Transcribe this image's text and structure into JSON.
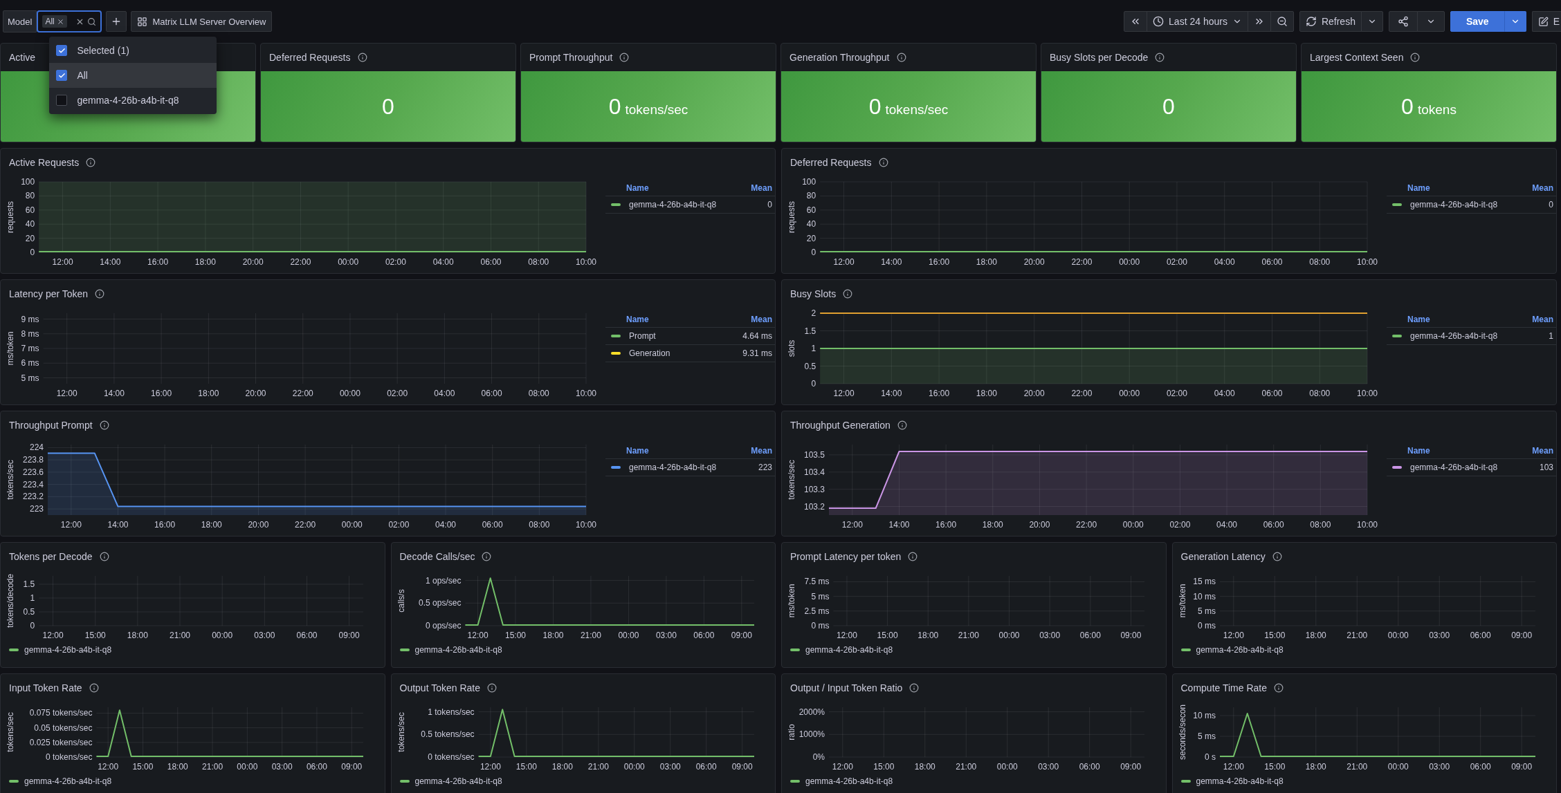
{
  "toolbar": {
    "variable": {
      "label": "Model",
      "chips": [
        "All"
      ]
    },
    "dashboard_link": "Matrix LLM Server Overview",
    "time_range": "Last 24 hours",
    "refresh": "Refresh",
    "save": "Save",
    "edit": "E"
  },
  "dropdown": {
    "options": [
      {
        "label": "Selected (1)",
        "checked": true,
        "selected": false
      },
      {
        "label": "All",
        "checked": true,
        "selected": true
      },
      {
        "label": "gemma-4-26b-a4b-it-q8",
        "checked": false,
        "selected": false
      }
    ]
  },
  "stats": [
    {
      "title": "Active"
    },
    {
      "title": "Deferred Requests",
      "value": "0"
    },
    {
      "title": "Prompt Throughput",
      "value": "0",
      "unit": "tokens/sec"
    },
    {
      "title": "Generation Throughput",
      "value": "0",
      "unit": "tokens/sec"
    },
    {
      "title": "Busy Slots per Decode",
      "value": "0"
    },
    {
      "title": "Largest Context Seen",
      "value": "0",
      "unit": "tokens"
    }
  ],
  "panels": [
    {
      "title": "Active Requests",
      "kind": "wide",
      "legend_columns": [
        "Name",
        "Mean"
      ],
      "legend_means": [
        "0"
      ],
      "chart_data": {
        "type": "line",
        "ylabel": "requests",
        "grid": true,
        "ylim": [
          0,
          100
        ],
        "yticks": [
          {
            "value": 0,
            "label": "0"
          },
          {
            "value": 20,
            "label": "20"
          },
          {
            "value": 40,
            "label": "40"
          },
          {
            "value": 60,
            "label": "60"
          },
          {
            "value": 80,
            "label": "80"
          },
          {
            "value": 100,
            "label": "100"
          }
        ],
        "categories": [
          null,
          "12:00",
          null,
          "14:00",
          null,
          "16:00",
          null,
          "18:00",
          null,
          "20:00",
          null,
          "22:00",
          null,
          "00:00",
          null,
          "02:00",
          null,
          "04:00",
          null,
          "06:00",
          null,
          "08:00",
          null,
          "10:00"
        ],
        "series": [
          {
            "name": "gemma-4-26b-a4b-it-q8",
            "color": "#73bf69",
            "values": [
              0,
              0,
              0,
              0,
              0,
              0,
              0,
              0,
              0,
              0,
              0,
              0,
              0,
              0,
              0,
              0,
              0,
              0,
              0,
              0,
              0,
              0,
              0,
              0
            ]
          }
        ],
        "bands": [
          {
            "axis": "y",
            "from": 0,
            "to": 100,
            "color": "#73bf69"
          }
        ]
      }
    },
    {
      "title": "Deferred Requests",
      "kind": "wide",
      "legend_columns": [
        "Name",
        "Mean"
      ],
      "legend_means": [
        "0"
      ],
      "chart_data": {
        "type": "line",
        "ylabel": "requests",
        "grid": true,
        "ylim": [
          0,
          100
        ],
        "yticks": [
          {
            "value": 0,
            "label": "0"
          },
          {
            "value": 20,
            "label": "20"
          },
          {
            "value": 40,
            "label": "40"
          },
          {
            "value": 60,
            "label": "60"
          },
          {
            "value": 80,
            "label": "80"
          },
          {
            "value": 100,
            "label": "100"
          }
        ],
        "categories": [
          null,
          "12:00",
          null,
          "14:00",
          null,
          "16:00",
          null,
          "18:00",
          null,
          "20:00",
          null,
          "22:00",
          null,
          "00:00",
          null,
          "02:00",
          null,
          "04:00",
          null,
          "06:00",
          null,
          "08:00",
          null,
          "10:00"
        ],
        "series": [
          {
            "name": "gemma-4-26b-a4b-it-q8",
            "color": "#73bf69",
            "values": [
              0,
              0,
              0,
              0,
              0,
              0,
              0,
              0,
              0,
              0,
              0,
              0,
              0,
              0,
              0,
              0,
              0,
              0,
              0,
              0,
              0,
              0,
              0,
              0
            ]
          }
        ]
      }
    },
    {
      "title": "Latency per Token",
      "kind": "wide",
      "legend_columns": [
        "Name",
        "Mean"
      ],
      "legend_means": [
        "4.64 ms",
        "9.31 ms"
      ],
      "chart_data": {
        "type": "line",
        "ylabel": "ms/token",
        "grid": true,
        "ylim": [
          4.6,
          9.4
        ],
        "yticks": [
          {
            "value": 5,
            "label": "5 ms"
          },
          {
            "value": 6,
            "label": "6 ms"
          },
          {
            "value": 7,
            "label": "7 ms"
          },
          {
            "value": 8,
            "label": "8 ms"
          },
          {
            "value": 9,
            "label": "9 ms"
          }
        ],
        "categories": [
          null,
          "12:00",
          null,
          "14:00",
          null,
          "16:00",
          null,
          "18:00",
          null,
          "20:00",
          null,
          "22:00",
          null,
          "00:00",
          null,
          "02:00",
          null,
          "04:00",
          null,
          "06:00",
          null,
          "08:00",
          null,
          "10:00"
        ],
        "series": [
          {
            "name": "Prompt",
            "color": "#73bf69",
            "values": [
              null,
              null,
              null,
              null,
              null,
              null,
              null,
              null,
              null,
              null,
              null,
              null,
              null,
              null,
              null,
              null,
              null,
              null,
              null,
              null,
              null,
              null,
              null,
              null
            ]
          },
          {
            "name": "Generation",
            "color": "#fade2a",
            "values": [
              null,
              null,
              null,
              null,
              null,
              null,
              null,
              null,
              null,
              null,
              null,
              null,
              null,
              null,
              null,
              null,
              null,
              null,
              null,
              null,
              null,
              null,
              null,
              null
            ]
          }
        ]
      }
    },
    {
      "title": "Busy Slots",
      "kind": "wide",
      "legend_columns": [
        "Name",
        "Mean"
      ],
      "legend_means": [
        "1"
      ],
      "chart_data": {
        "type": "area",
        "ylabel": "slots",
        "grid": true,
        "ylim": [
          0,
          2
        ],
        "yticks": [
          {
            "value": 0,
            "label": "0"
          },
          {
            "value": 0.5,
            "label": "0.5"
          },
          {
            "value": 1,
            "label": "1"
          },
          {
            "value": 1.5,
            "label": "1.5"
          },
          {
            "value": 2,
            "label": "2"
          }
        ],
        "categories": [
          null,
          "12:00",
          null,
          "14:00",
          null,
          "16:00",
          null,
          "18:00",
          null,
          "20:00",
          null,
          "22:00",
          null,
          "00:00",
          null,
          "02:00",
          null,
          "04:00",
          null,
          "06:00",
          null,
          "08:00",
          null,
          "10:00"
        ],
        "series": [
          {
            "name": "gemma-4-26b-a4b-it-q8",
            "color": "#73bf69",
            "values": [
              1,
              1,
              1,
              1,
              1,
              1,
              1,
              1,
              1,
              1,
              1,
              1,
              1,
              1,
              1,
              1,
              1,
              1,
              1,
              1,
              1,
              1,
              1,
              1
            ]
          }
        ],
        "ref_lines": [
          {
            "axis": "y",
            "value": 2,
            "color": "#e0a030"
          }
        ]
      }
    },
    {
      "title": "Throughput Prompt",
      "kind": "wide",
      "legend_columns": [
        "Name",
        "Mean"
      ],
      "legend_means": [
        "223"
      ],
      "chart_data": {
        "type": "area",
        "ylabel": "tokens/sec",
        "grid": true,
        "ylim": [
          222.9,
          224.05
        ],
        "yticks": [
          {
            "value": 223,
            "label": "223"
          },
          {
            "value": 223.2,
            "label": "223.2"
          },
          {
            "value": 223.4,
            "label": "223.4"
          },
          {
            "value": 223.6,
            "label": "223.6"
          },
          {
            "value": 223.8,
            "label": "223.8"
          },
          {
            "value": 224,
            "label": "224"
          }
        ],
        "categories": [
          null,
          "12:00",
          null,
          "14:00",
          null,
          "16:00",
          null,
          "18:00",
          null,
          "20:00",
          null,
          "22:00",
          null,
          "00:00",
          null,
          "02:00",
          null,
          "04:00",
          null,
          "06:00",
          null,
          "08:00",
          null,
          "10:00"
        ],
        "series": [
          {
            "name": "gemma-4-26b-a4b-it-q8",
            "color": "#5794f2",
            "values": [
              223.91,
              223.91,
              223.91,
              223.04,
              223.04,
              223.04,
              223.04,
              223.04,
              223.04,
              223.04,
              223.04,
              223.04,
              223.04,
              223.04,
              223.04,
              223.04,
              223.04,
              223.04,
              223.04,
              223.04,
              223.04,
              223.04,
              223.04,
              223.04
            ]
          }
        ]
      }
    },
    {
      "title": "Throughput Generation",
      "kind": "wide",
      "legend_columns": [
        "Name",
        "Mean"
      ],
      "legend_means": [
        "103"
      ],
      "chart_data": {
        "type": "area",
        "ylabel": "tokens/sec",
        "grid": true,
        "ylim": [
          103.15,
          103.56
        ],
        "yticks": [
          {
            "value": 103.2,
            "label": "103.2"
          },
          {
            "value": 103.3,
            "label": "103.3"
          },
          {
            "value": 103.4,
            "label": "103.4"
          },
          {
            "value": 103.5,
            "label": "103.5"
          }
        ],
        "categories": [
          null,
          "12:00",
          null,
          "14:00",
          null,
          "16:00",
          null,
          "18:00",
          null,
          "20:00",
          null,
          "22:00",
          null,
          "00:00",
          null,
          "02:00",
          null,
          "04:00",
          null,
          "06:00",
          null,
          "08:00",
          null,
          "10:00"
        ],
        "series": [
          {
            "name": "gemma-4-26b-a4b-it-q8",
            "color": "#ca95e5",
            "values": [
              103.19,
              103.19,
              103.19,
              103.52,
              103.52,
              103.52,
              103.52,
              103.52,
              103.52,
              103.52,
              103.52,
              103.52,
              103.52,
              103.52,
              103.52,
              103.52,
              103.52,
              103.52,
              103.52,
              103.52,
              103.52,
              103.52,
              103.52,
              103.52
            ]
          }
        ]
      }
    },
    {
      "title": "Tokens per Decode",
      "kind": "small",
      "chart_data": {
        "type": "line",
        "ylabel": "tokens/decode",
        "grid": true,
        "ylim": [
          0,
          1.8
        ],
        "yticks": [
          {
            "value": 0,
            "label": "0"
          },
          {
            "value": 0.5,
            "label": "0.5"
          },
          {
            "value": 1,
            "label": "1"
          },
          {
            "value": 1.5,
            "label": "1.5"
          }
        ],
        "categories": [
          null,
          "12:00",
          null,
          null,
          "15:00",
          null,
          null,
          "18:00",
          null,
          null,
          "21:00",
          null,
          null,
          "00:00",
          null,
          null,
          "03:00",
          null,
          null,
          "06:00",
          null,
          null,
          "09:00",
          null
        ],
        "series": [
          {
            "name": "gemma-4-26b-a4b-it-q8",
            "color": "#73bf69",
            "values": [
              null,
              null,
              null,
              null,
              null,
              null,
              null,
              null,
              null,
              null,
              null,
              null,
              null,
              null,
              null,
              null,
              null,
              null,
              null,
              null,
              null,
              null,
              null,
              null
            ]
          }
        ]
      }
    },
    {
      "title": "Decode Calls/sec",
      "kind": "small",
      "chart_data": {
        "type": "line",
        "ylabel": "calls/s",
        "grid": true,
        "ylim": [
          0,
          1.1
        ],
        "yticks": [
          {
            "value": 0,
            "label": "0 ops/sec"
          },
          {
            "value": 0.5,
            "label": "0.5 ops/sec"
          },
          {
            "value": 1,
            "label": "1 ops/sec"
          }
        ],
        "categories": [
          null,
          "12:00",
          null,
          null,
          "15:00",
          null,
          null,
          "18:00",
          null,
          null,
          "21:00",
          null,
          null,
          "00:00",
          null,
          null,
          "03:00",
          null,
          null,
          "06:00",
          null,
          null,
          "09:00",
          null
        ],
        "series": [
          {
            "name": "gemma-4-26b-a4b-it-q8",
            "color": "#73bf69",
            "values": [
              0,
              0,
              1.05,
              0,
              0,
              0,
              0,
              0,
              0,
              0,
              0,
              0,
              0,
              0,
              0,
              0,
              0,
              0,
              0,
              0,
              0,
              0,
              0,
              0
            ]
          }
        ]
      }
    },
    {
      "title": "Prompt Latency per token",
      "kind": "small",
      "chart_data": {
        "type": "line",
        "ylabel": "ms/token",
        "grid": true,
        "ylim": [
          0,
          8.5
        ],
        "yticks": [
          {
            "value": 0,
            "label": "0 ms"
          },
          {
            "value": 2.5,
            "label": "2.5 ms"
          },
          {
            "value": 5,
            "label": "5 ms"
          },
          {
            "value": 7.5,
            "label": "7.5 ms"
          }
        ],
        "categories": [
          null,
          "12:00",
          null,
          null,
          "15:00",
          null,
          null,
          "18:00",
          null,
          null,
          "21:00",
          null,
          null,
          "00:00",
          null,
          null,
          "03:00",
          null,
          null,
          "06:00",
          null,
          null,
          "09:00",
          null
        ],
        "series": [
          {
            "name": "gemma-4-26b-a4b-it-q8",
            "color": "#73bf69",
            "values": [
              null,
              null,
              null,
              null,
              null,
              null,
              null,
              null,
              null,
              null,
              null,
              null,
              null,
              null,
              null,
              null,
              null,
              null,
              null,
              null,
              null,
              null,
              null,
              null
            ]
          }
        ]
      }
    },
    {
      "title": "Generation Latency",
      "kind": "small",
      "chart_data": {
        "type": "line",
        "ylabel": "ms/token",
        "grid": true,
        "ylim": [
          0,
          17
        ],
        "yticks": [
          {
            "value": 0,
            "label": "0 ms"
          },
          {
            "value": 5,
            "label": "5 ms"
          },
          {
            "value": 10,
            "label": "10 ms"
          },
          {
            "value": 15,
            "label": "15 ms"
          }
        ],
        "categories": [
          null,
          "12:00",
          null,
          null,
          "15:00",
          null,
          null,
          "18:00",
          null,
          null,
          "21:00",
          null,
          null,
          "00:00",
          null,
          null,
          "03:00",
          null,
          null,
          "06:00",
          null,
          null,
          "09:00",
          null
        ],
        "series": [
          {
            "name": "gemma-4-26b-a4b-it-q8",
            "color": "#73bf69",
            "values": [
              null,
              null,
              null,
              null,
              null,
              null,
              null,
              null,
              null,
              null,
              null,
              null,
              null,
              null,
              null,
              null,
              null,
              null,
              null,
              null,
              null,
              null,
              null,
              null
            ]
          }
        ]
      }
    },
    {
      "title": "Input Token Rate",
      "kind": "small",
      "chart_data": {
        "type": "line",
        "ylabel": "tokens/sec",
        "grid": true,
        "ylim": [
          0,
          0.085
        ],
        "yticks": [
          {
            "value": 0,
            "label": "0 tokens/sec"
          },
          {
            "value": 0.025,
            "label": "0.025 tokens/sec"
          },
          {
            "value": 0.05,
            "label": "0.05 tokens/sec"
          },
          {
            "value": 0.075,
            "label": "0.075 tokens/sec"
          }
        ],
        "categories": [
          null,
          "12:00",
          null,
          null,
          "15:00",
          null,
          null,
          "18:00",
          null,
          null,
          "21:00",
          null,
          null,
          "00:00",
          null,
          null,
          "03:00",
          null,
          null,
          "06:00",
          null,
          null,
          "09:00",
          null
        ],
        "series": [
          {
            "name": "gemma-4-26b-a4b-it-q8",
            "color": "#73bf69",
            "values": [
              0,
              0,
              0.08,
              0,
              0,
              0,
              0,
              0,
              0,
              0,
              0,
              0,
              0,
              0,
              0,
              0,
              0,
              0,
              0,
              0,
              0,
              0,
              0,
              0
            ]
          }
        ]
      }
    },
    {
      "title": "Output Token Rate",
      "kind": "small",
      "chart_data": {
        "type": "line",
        "ylabel": "tokens/sec",
        "grid": true,
        "ylim": [
          0,
          1.1
        ],
        "yticks": [
          {
            "value": 0,
            "label": "0 tokens/sec"
          },
          {
            "value": 0.5,
            "label": "0.5 tokens/sec"
          },
          {
            "value": 1,
            "label": "1 tokens/sec"
          }
        ],
        "categories": [
          null,
          "12:00",
          null,
          null,
          "15:00",
          null,
          null,
          "18:00",
          null,
          null,
          "21:00",
          null,
          null,
          "00:00",
          null,
          null,
          "03:00",
          null,
          null,
          "06:00",
          null,
          null,
          "09:00",
          null
        ],
        "series": [
          {
            "name": "gemma-4-26b-a4b-it-q8",
            "color": "#73bf69",
            "values": [
              0,
              0,
              1.05,
              0,
              0,
              0,
              0,
              0,
              0,
              0,
              0,
              0,
              0,
              0,
              0,
              0,
              0,
              0,
              0,
              0,
              0,
              0,
              0,
              0
            ]
          }
        ]
      }
    },
    {
      "title": "Output / Input Token Ratio",
      "kind": "small",
      "chart_data": {
        "type": "line",
        "ylabel": "ratio",
        "grid": true,
        "ylim": [
          0,
          22
        ],
        "yticks": [
          {
            "value": 0,
            "label": "0%"
          },
          {
            "value": 10,
            "label": "1000%"
          },
          {
            "value": 20,
            "label": "2000%"
          }
        ],
        "categories": [
          null,
          "12:00",
          null,
          null,
          "15:00",
          null,
          null,
          "18:00",
          null,
          null,
          "21:00",
          null,
          null,
          "00:00",
          null,
          null,
          "03:00",
          null,
          null,
          "06:00",
          null,
          null,
          "09:00",
          null
        ],
        "series": [
          {
            "name": "gemma-4-26b-a4b-it-q8",
            "color": "#73bf69",
            "values": [
              null,
              null,
              null,
              null,
              null,
              null,
              null,
              null,
              null,
              null,
              null,
              null,
              null,
              null,
              null,
              null,
              null,
              null,
              null,
              null,
              null,
              null,
              null,
              null
            ]
          }
        ]
      }
    },
    {
      "title": "Compute Time Rate",
      "kind": "small",
      "chart_data": {
        "type": "line",
        "ylabel": "seconds/secon",
        "grid": true,
        "ylim": [
          0,
          12
        ],
        "yticks": [
          {
            "value": 0,
            "label": "0 s"
          },
          {
            "value": 5,
            "label": "5 ms"
          },
          {
            "value": 10,
            "label": "10 ms"
          }
        ],
        "categories": [
          null,
          "12:00",
          null,
          null,
          "15:00",
          null,
          null,
          "18:00",
          null,
          null,
          "21:00",
          null,
          null,
          "00:00",
          null,
          null,
          "03:00",
          null,
          null,
          "06:00",
          null,
          null,
          "09:00",
          null
        ],
        "series": [
          {
            "name": "gemma-4-26b-a4b-it-q8",
            "color": "#73bf69",
            "values": [
              0,
              0,
              10.5,
              0,
              0,
              0,
              0,
              0,
              0,
              0,
              0,
              0,
              0,
              0,
              0,
              0,
              0,
              0,
              0,
              0,
              0,
              0,
              0,
              0
            ]
          }
        ]
      }
    }
  ]
}
